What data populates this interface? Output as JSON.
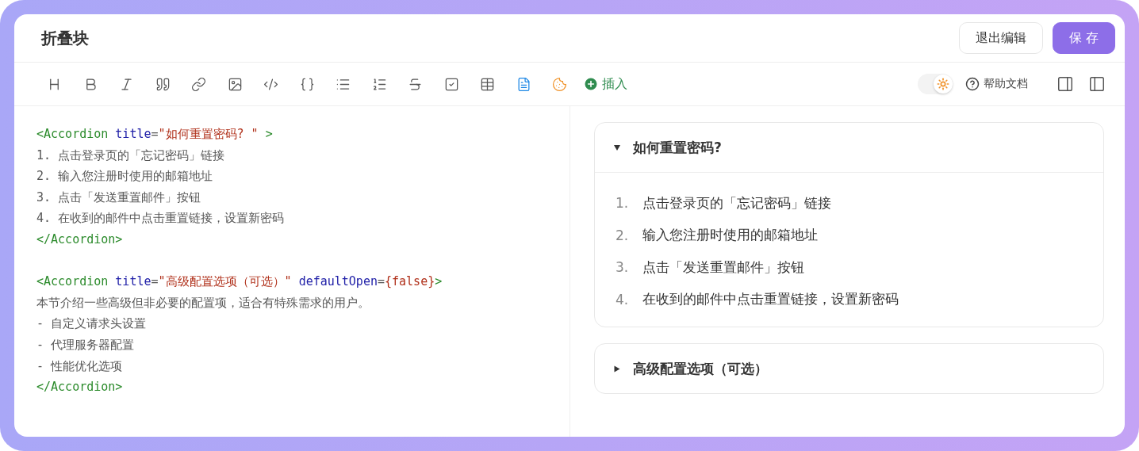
{
  "header": {
    "title": "折叠块",
    "buttons": [
      {
        "label": "退出编辑",
        "kind": "secondary"
      },
      {
        "label": "保 存",
        "kind": "primary"
      }
    ]
  },
  "toolbar": {
    "insert_label": "插入",
    "theme_toggle": {
      "on": true
    },
    "help_label": "帮助文档"
  },
  "editor": {
    "lines": [
      {
        "kind": "code",
        "tokens": [
          {
            "kind": "tag",
            "text": "<Accordion "
          },
          {
            "kind": "attr",
            "text": "title"
          },
          {
            "kind": "plain",
            "text": "="
          },
          {
            "kind": "string",
            "text": "\"如何重置密码? \" "
          },
          {
            "kind": "tag",
            "text": ">"
          }
        ]
      },
      {
        "kind": "code",
        "tokens": [
          {
            "kind": "plain",
            "text": "1. 点击登录页的「忘记密码」链接"
          }
        ]
      },
      {
        "kind": "code",
        "tokens": [
          {
            "kind": "plain",
            "text": "2. 输入您注册时使用的邮箱地址"
          }
        ]
      },
      {
        "kind": "code",
        "tokens": [
          {
            "kind": "plain",
            "text": "3. 点击「发送重置邮件」按钮"
          }
        ]
      },
      {
        "kind": "code",
        "tokens": [
          {
            "kind": "plain",
            "text": "4. 在收到的邮件中点击重置链接，设置新密码"
          }
        ]
      },
      {
        "kind": "code",
        "tokens": [
          {
            "kind": "tag",
            "text": "</Accordion>"
          }
        ]
      },
      {
        "kind": "blank"
      },
      {
        "kind": "code",
        "tokens": [
          {
            "kind": "tag",
            "text": "<Accordion "
          },
          {
            "kind": "attr",
            "text": "title"
          },
          {
            "kind": "plain",
            "text": "="
          },
          {
            "kind": "string",
            "text": "\"高级配置选项（可选）\" "
          },
          {
            "kind": "attr",
            "text": "defaultOpen"
          },
          {
            "kind": "plain",
            "text": "="
          },
          {
            "kind": "string",
            "text": "{false}"
          },
          {
            "kind": "tag",
            "text": ">"
          }
        ]
      },
      {
        "kind": "code",
        "tokens": [
          {
            "kind": "plain",
            "text": "本节介绍一些高级但非必要的配置项，适合有特殊需求的用户。"
          }
        ]
      },
      {
        "kind": "code",
        "tokens": [
          {
            "kind": "plain",
            "text": "- 自定义请求头设置"
          }
        ]
      },
      {
        "kind": "code",
        "tokens": [
          {
            "kind": "plain",
            "text": "- 代理服务器配置"
          }
        ]
      },
      {
        "kind": "code",
        "tokens": [
          {
            "kind": "plain",
            "text": "- 性能优化选项"
          }
        ]
      },
      {
        "kind": "code",
        "tokens": [
          {
            "kind": "tag",
            "text": "</Accordion>"
          }
        ]
      }
    ]
  },
  "preview": {
    "accordions": [
      {
        "title": "如何重置密码?",
        "expanded": true,
        "items": [
          {
            "number": "1.",
            "text": "点击登录页的「忘记密码」链接"
          },
          {
            "number": "2.",
            "text": "输入您注册时使用的邮箱地址"
          },
          {
            "number": "3.",
            "text": "点击「发送重置邮件」按钮"
          },
          {
            "number": "4.",
            "text": "在收到的邮件中点击重置链接，设置新密码"
          }
        ]
      },
      {
        "title": "高级配置选项（可选）",
        "expanded": false
      }
    ]
  }
}
